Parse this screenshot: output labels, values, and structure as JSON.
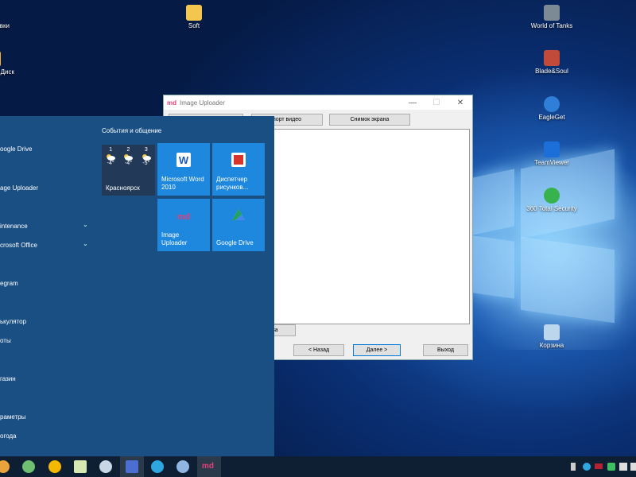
{
  "desktop_icons": [
    {
      "label": "Soft",
      "icon": "folder-icon",
      "color": "#f3c64e"
    },
    {
      "label": "World of Tanks",
      "icon": "world-of-tanks-icon",
      "color": "#7b8a94"
    },
    {
      "label": "Blade&Soul",
      "icon": "blade-and-soul-icon",
      "color": "#c24a3a"
    },
    {
      "label": "EagleGet",
      "icon": "eagleget-icon",
      "color": "#2f7ed8"
    },
    {
      "label": "TeamViewer",
      "icon": "teamviewer-icon",
      "color": "#1c6ed8"
    },
    {
      "label": "360 Total Security",
      "icon": "360-security-icon",
      "color": "#37b24d"
    },
    {
      "label": "Корзина",
      "icon": "recycle-bin-icon",
      "color": "#bcd6ee"
    },
    {
      "label": "вки",
      "icon": "partial-icon",
      "color": "#1e90ff"
    },
    {
      "label": "Диск",
      "icon": "disk-icon",
      "color": "#f3b13a"
    }
  ],
  "window": {
    "title": "Image Uploader",
    "tab_buttons": [
      "",
      "порт видео",
      "Снимок экрана"
    ],
    "small_button": "вва",
    "back": "< Назад",
    "next": "Далее >",
    "exit": "Выход"
  },
  "start_menu": {
    "items": [
      {
        "label": "oogle Drive",
        "chevron": false
      },
      {
        "label": "age Uploader",
        "chevron": false
      },
      {
        "label": "intenance",
        "chevron": true
      },
      {
        "label": "crosoft Office",
        "chevron": true
      },
      {
        "label": "egram",
        "chevron": false
      },
      {
        "label": "ькулятор",
        "chevron": false
      },
      {
        "label": "оты",
        "chevron": false
      },
      {
        "label": "газин",
        "chevron": false
      },
      {
        "label": "раметры",
        "chevron": false
      },
      {
        "label": "огода",
        "chevron": false
      }
    ],
    "group_title": "События и общение",
    "weather": {
      "days": [
        {
          "num": "1",
          "temp": "-4°"
        },
        {
          "num": "2",
          "temp": "-4°"
        },
        {
          "num": "3",
          "temp": "-5°"
        }
      ],
      "city": "Красноярск"
    },
    "tiles": [
      {
        "label": "Microsoft Word 2010",
        "icon": "word-icon"
      },
      {
        "label": "Диспетчер рисунков...",
        "icon": "picture-manager-icon"
      },
      {
        "label": "Image Uploader",
        "icon": "image-uploader-icon"
      },
      {
        "label": "Google Drive",
        "icon": "google-drive-icon"
      }
    ]
  },
  "taskbar": {
    "apps": [
      {
        "icon": "chrome-icon",
        "color": "#e8a33c"
      },
      {
        "icon": "globe-icon",
        "color": "#6fbf73"
      },
      {
        "icon": "aimp-icon",
        "color": "#f5b800"
      },
      {
        "icon": "notepad-icon",
        "color": "#d7e9b0"
      },
      {
        "icon": "lock-icon",
        "color": "#c9d6e6"
      },
      {
        "icon": "floppy-icon",
        "color": "#4a6fd1"
      },
      {
        "icon": "telegram-icon",
        "color": "#2ea6df"
      },
      {
        "icon": "network-icon",
        "color": "#8fb6e0"
      },
      {
        "icon": "image-uploader-icon",
        "color": "#e0407a"
      }
    ],
    "tray": [
      {
        "icon": "usb-icon"
      },
      {
        "icon": "telegram-tray-icon"
      },
      {
        "icon": "flag-icon"
      },
      {
        "icon": "shield-tray-icon"
      },
      {
        "icon": "network-tray-icon"
      },
      {
        "icon": "volume-icon"
      }
    ]
  }
}
